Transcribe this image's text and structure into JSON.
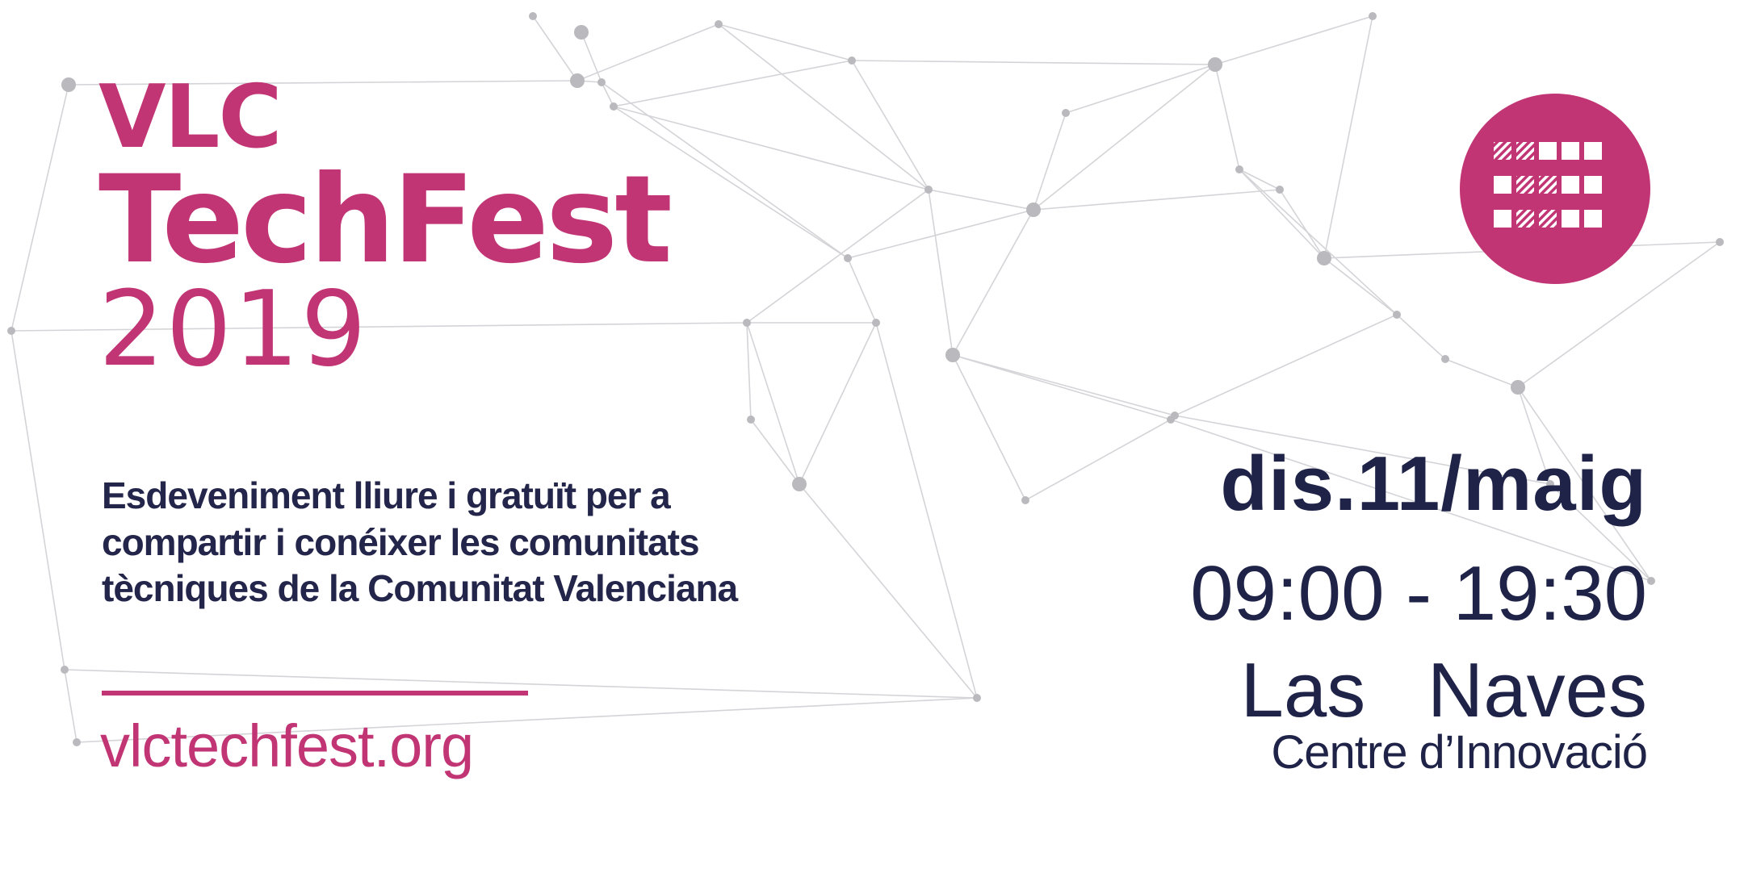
{
  "title": {
    "line1": "VLC",
    "line2": "TechFest",
    "line3": "2019"
  },
  "description": {
    "line1": "Esdeveniment lliure i gratuït per a",
    "line2": "compartir i conéixer les comunitats",
    "line3": "tècniques de la Comunitat Valenciana"
  },
  "website": "vlctechfest.org",
  "event": {
    "date": "dis.11/maig",
    "time": "09:00 - 19:30",
    "venue": "Las Naves",
    "venue_detail": "Centre d’Innovació"
  },
  "logo": {
    "icon": "grid-pattern-icon"
  },
  "colors": {
    "brand": "#c23574",
    "text_dark": "#1f2348",
    "network_lines": "#d4d4d8",
    "network_nodes": "#b9b9be",
    "background": "#ffffff"
  }
}
